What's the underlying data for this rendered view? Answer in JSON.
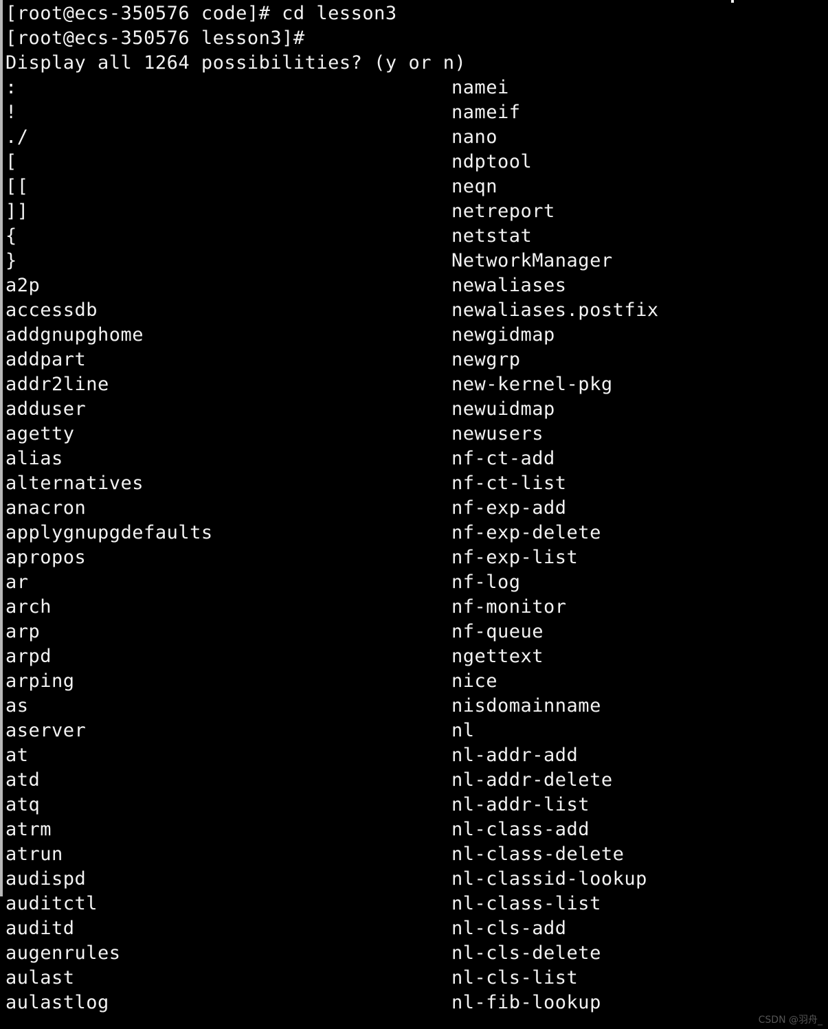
{
  "terminal": {
    "background_color": "#000000",
    "foreground_color": "#f2f2f2",
    "header_lines": [
      "[root@ecs-350576 code]# cd lesson3",
      "[root@ecs-350576 lesson3]#",
      "Display all 1264 possibilities? (y or n)"
    ],
    "prompt_user": "root",
    "prompt_host": "ecs-350576",
    "prompt_dir_before": "code",
    "prompt_dir_after": "lesson3",
    "command_entered": "cd lesson3",
    "completion_prompt": "Display all 1264 possibilities? (y or n)",
    "possibilities_count": "1264",
    "completion_answer_options": "(y or n)",
    "columns": {
      "left": [
        ":",
        "!",
        "./",
        "[",
        "[[",
        "]]",
        "{",
        "}",
        "a2p",
        "accessdb",
        "addgnupghome",
        "addpart",
        "addr2line",
        "adduser",
        "agetty",
        "alias",
        "alternatives",
        "anacron",
        "applygnupgdefaults",
        "apropos",
        "ar",
        "arch",
        "arp",
        "arpd",
        "arping",
        "as",
        "aserver",
        "at",
        "atd",
        "atq",
        "atrm",
        "atrun",
        "audispd",
        "auditctl",
        "auditd",
        "augenrules",
        "aulast",
        "aulastlog"
      ],
      "right": [
        "namei",
        "nameif",
        "nano",
        "ndptool",
        "neqn",
        "netreport",
        "netstat",
        "NetworkManager",
        "newaliases",
        "newaliases.postfix",
        "newgidmap",
        "newgrp",
        "new-kernel-pkg",
        "newuidmap",
        "newusers",
        "nf-ct-add",
        "nf-ct-list",
        "nf-exp-add",
        "nf-exp-delete",
        "nf-exp-list",
        "nf-log",
        "nf-monitor",
        "nf-queue",
        "ngettext",
        "nice",
        "nisdomainname",
        "nl",
        "nl-addr-add",
        "nl-addr-delete",
        "nl-addr-list",
        "nl-class-add",
        "nl-class-delete",
        "nl-classid-lookup",
        "nl-class-list",
        "nl-cls-add",
        "nl-cls-delete",
        "nl-cls-list",
        "nl-fib-lookup"
      ]
    }
  },
  "watermark": {
    "text": "CSDN @羽舟_"
  }
}
